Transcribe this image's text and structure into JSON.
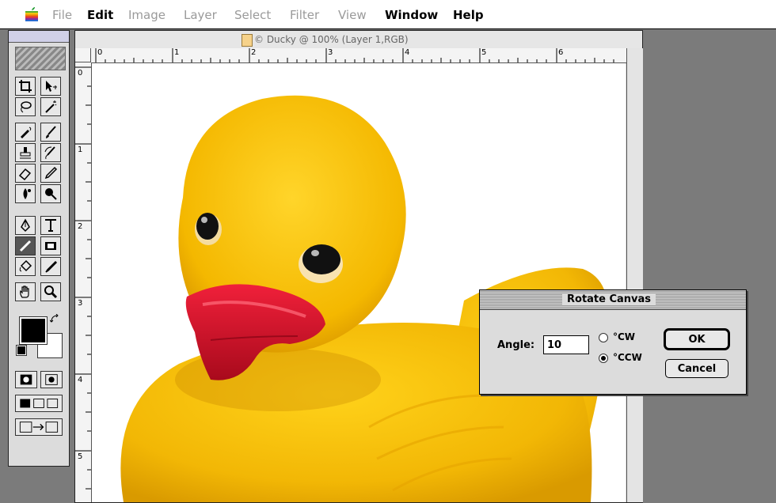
{
  "menubar": {
    "apple_icon": "apple-logo",
    "items": [
      {
        "label": "File",
        "enabled": false
      },
      {
        "label": "Edit",
        "enabled": true
      },
      {
        "label": "Image",
        "enabled": false
      },
      {
        "label": "Layer",
        "enabled": false
      },
      {
        "label": "Select",
        "enabled": false
      },
      {
        "label": "Filter",
        "enabled": false
      },
      {
        "label": "View",
        "enabled": false
      },
      {
        "label": "Window",
        "enabled": true
      },
      {
        "label": "Help",
        "enabled": true
      }
    ]
  },
  "document": {
    "title": "© Ducky @ 100% (Layer 1,RGB)",
    "ruler_h_labels": [
      "0",
      "1",
      "2",
      "3",
      "4",
      "5",
      "6"
    ],
    "ruler_v_labels": [
      "0",
      "1",
      "2",
      "3",
      "4",
      "5"
    ]
  },
  "toolbox": {
    "tools": [
      "crop-icon",
      "move-icon",
      "lasso-icon",
      "magic-wand-icon",
      "airbrush-icon",
      "paintbrush-icon",
      "rubber-stamp-icon",
      "history-brush-icon",
      "eraser-icon",
      "pencil-icon",
      "blur-icon",
      "dodge-icon",
      "pen-icon",
      "type-icon",
      "line-icon",
      "gradient-icon",
      "paint-bucket-icon",
      "eyedropper-icon",
      "hand-icon",
      "zoom-icon"
    ],
    "foreground_color": "#000000",
    "background_color": "#ffffff"
  },
  "dialog": {
    "title": "Rotate Canvas",
    "angle_label": "Angle:",
    "angle_value": "10",
    "option_cw": "°CW",
    "option_ccw": "°CCW",
    "selected": "°CCW",
    "ok_label": "OK",
    "cancel_label": "Cancel"
  },
  "colors": {
    "duck_yellow": "#f2b705",
    "beak_red": "#d4142a"
  }
}
